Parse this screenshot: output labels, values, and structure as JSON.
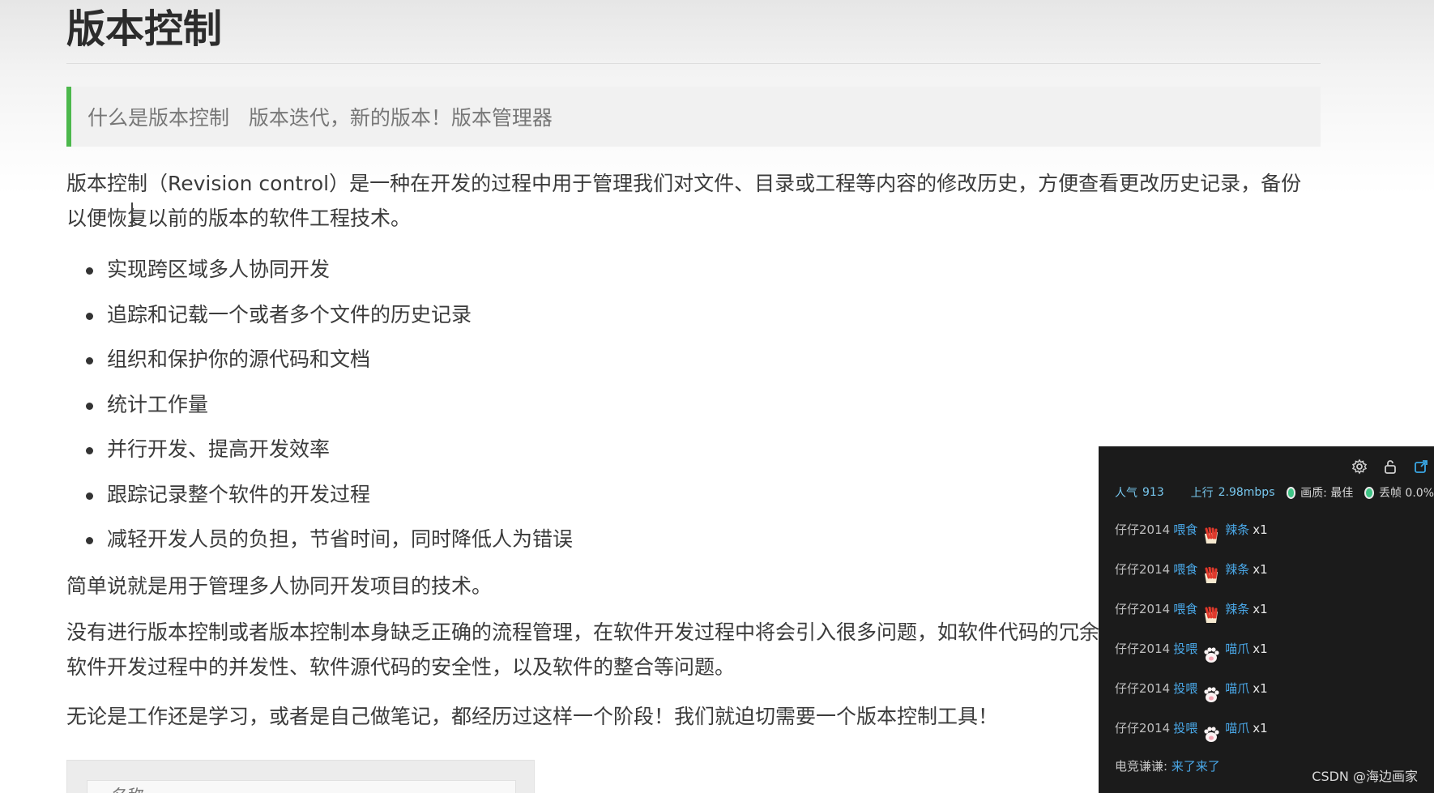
{
  "article": {
    "title": "版本控制",
    "quote": "什么是版本控制   版本迭代，新的版本！版本管理器",
    "intro": "版本控制（Revision control）是一种在开发的过程中用于管理我们对文件、目录或工程等内容的修改历史，方便查看更改历史记录，备份以便恢复以前的版本的软件工程技术。",
    "features": [
      "实现跨区域多人协同开发",
      "追踪和记载一个或者多个文件的历史记录",
      "组织和保护你的源代码和文档",
      "统计工作量",
      "并行开发、提高开发效率",
      "跟踪记录整个软件的开发过程",
      "减轻开发人员的负担，节省时间，同时降低人为错误"
    ],
    "simple": "简单说就是用于管理多人协同开发项目的技术。",
    "problem": "没有进行版本控制或者版本控制本身缺乏正确的流程管理，在软件开发过程中将会引入很多问题，如软件代码的冗余、软件过程的事物性、软件开发过程中的并发性、软件源代码的安全性，以及软件的整合等问题。",
    "need": "无论是工作还是学习，或者是自己做笔记，都经历过这样一个阶段！我们就迫切需要一个版本控制工具！",
    "image_caption": "名称"
  },
  "stream": {
    "icons": [
      "gear-icon",
      "lock-icon",
      "popout-icon"
    ],
    "popularity_label": "人气",
    "popularity_value": "913",
    "upload_label": "上行",
    "upload_value": "2.98mbps",
    "quality_label": "画质: 最佳",
    "drop_label": "丢帧 0.0%",
    "status_color": "#3ec485",
    "gifts": [
      {
        "user": "仔仔2014",
        "action": "喂食",
        "item": "辣条",
        "count": "x1",
        "icon": "latiao-gift-icon"
      },
      {
        "user": "仔仔2014",
        "action": "喂食",
        "item": "辣条",
        "count": "x1",
        "icon": "latiao-gift-icon"
      },
      {
        "user": "仔仔2014",
        "action": "喂食",
        "item": "辣条",
        "count": "x1",
        "icon": "latiao-gift-icon"
      },
      {
        "user": "仔仔2014",
        "action": "投喂",
        "item": "喵爪",
        "count": "x1",
        "icon": "cat-paw-gift-icon"
      },
      {
        "user": "仔仔2014",
        "action": "投喂",
        "item": "喵爪",
        "count": "x1",
        "icon": "cat-paw-gift-icon"
      },
      {
        "user": "仔仔2014",
        "action": "投喂",
        "item": "喵爪",
        "count": "x1",
        "icon": "cat-paw-gift-icon"
      }
    ],
    "chat": {
      "user": "电竞谦谦:",
      "text": "来了来了"
    }
  },
  "watermark": "CSDN @海边画家"
}
